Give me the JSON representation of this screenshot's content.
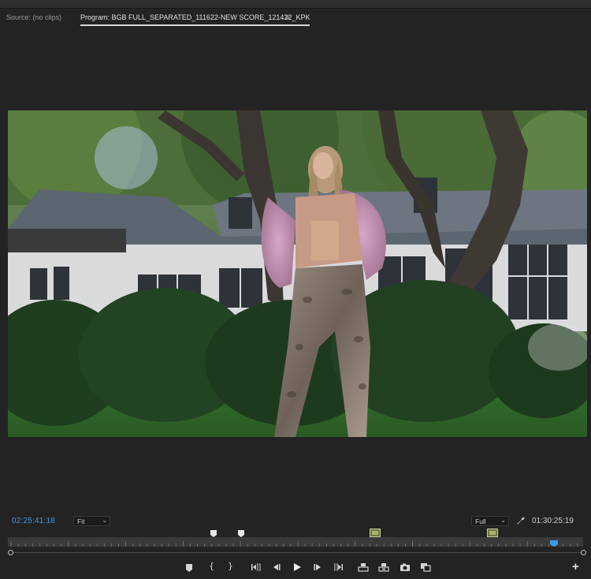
{
  "tabs": {
    "source_label": "Source: (no clips)",
    "program_label": "Program: BGB FULL_SEPARATED_111622-NEW SCORE_121422_KPK",
    "menu_glyph": "≡"
  },
  "viewer": {
    "content": "video-frame"
  },
  "controls": {
    "current_timecode": "02:25:41:18",
    "zoom_value": "Fit",
    "resolution_value": "Full",
    "duration_timecode": "01:30:25:19",
    "wrench_icon": "wrench-icon",
    "chevron": "⌄"
  },
  "transport": {
    "mark_in": "{",
    "mark_out": "}",
    "icons": [
      "add-marker-icon",
      "mark-in-icon",
      "mark-out-icon",
      "go-to-in-icon",
      "step-back-icon",
      "play-icon",
      "step-forward-icon",
      "go-to-out-icon",
      "lift-icon",
      "extract-icon",
      "export-frame-icon",
      "comparison-view-icon"
    ],
    "add_button": "+"
  },
  "colors": {
    "accent_timecode": "#3d9be9",
    "playhead": "#3d9be9",
    "panel_bg": "#232323",
    "marker_green": "#6a7a3a"
  }
}
